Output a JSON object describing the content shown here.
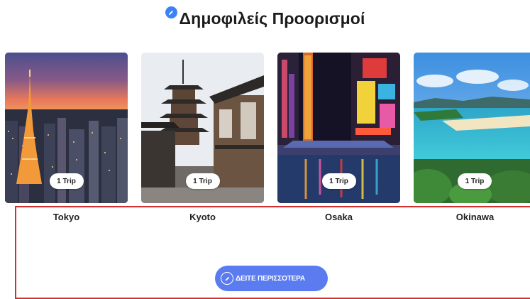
{
  "header": {
    "title": "Δημοφιλείς Προορισμοί",
    "edit_icon": "pencil-icon"
  },
  "destinations": [
    {
      "city": "Tokyo",
      "trips": "1 Trip"
    },
    {
      "city": "Kyoto",
      "trips": "1 Trip"
    },
    {
      "city": "Osaka",
      "trips": "1 Trip"
    },
    {
      "city": "Okinawa",
      "trips": "1 Trip"
    }
  ],
  "see_more": {
    "label": "ΔΕΙΤΕ ΠΕΡΙΣΣΟΤΕΡΑ",
    "icon": "pencil-icon"
  },
  "colors": {
    "accent": "#5b7cf0",
    "selection": "#d32f2f",
    "title": "#1b1b1b"
  }
}
